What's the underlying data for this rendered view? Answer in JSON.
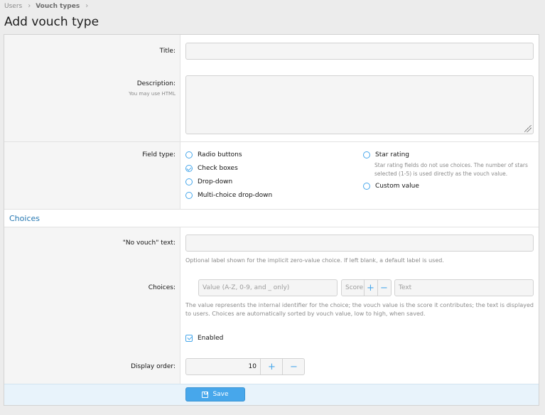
{
  "breadcrumb": {
    "items": [
      "Users",
      "Vouch types"
    ]
  },
  "page": {
    "title": "Add vouch type"
  },
  "form": {
    "title_label": "Title:",
    "description_label": "Description:",
    "description_hint": "You may use HTML",
    "field_type_label": "Field type:",
    "field_types": {
      "radio_buttons": "Radio buttons",
      "check_boxes": "Check boxes",
      "drop_down": "Drop-down",
      "multi_choice": "Multi-choice drop-down",
      "star_rating": "Star rating",
      "star_rating_hint": "Star rating fields do not use choices. The number of stars selected (1-5) is used directly as the vouch value.",
      "custom_value": "Custom value",
      "selected": "Check boxes"
    },
    "section_choices": "Choices",
    "no_vouch_label": "\"No vouch\" text:",
    "no_vouch_hint": "Optional label shown for the implicit zero-value choice. If left blank, a default label is used.",
    "choices_label": "Choices:",
    "choice_value_placeholder": "Value (A-Z, 0-9, and _ only)",
    "choice_score_placeholder": "Score",
    "choice_text_placeholder": "Text",
    "choices_hint": "The value represents the internal identifier for the choice; the vouch value is the score it contributes; the text is displayed to users. Choices are automatically sorted by vouch value, low to high, when saved.",
    "enabled_label": "Enabled",
    "enabled_checked": true,
    "display_order_label": "Display order:",
    "display_order_value": "10",
    "save_label": "Save"
  },
  "colors": {
    "accent": "#47a7eb",
    "section": "#2577b1",
    "footer": "#e8f3fb"
  }
}
